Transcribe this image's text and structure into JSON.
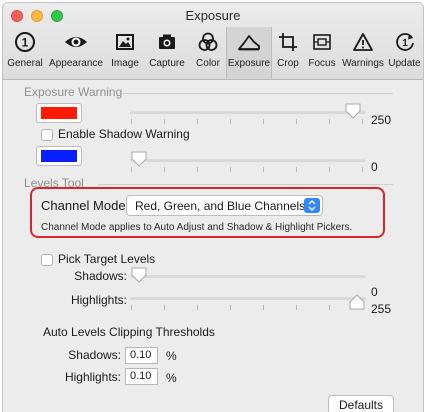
{
  "window": {
    "title": "Exposure"
  },
  "toolbar": {
    "selected": "Exposure",
    "items": [
      {
        "label": "General",
        "icon": "info-circle-icon"
      },
      {
        "label": "Appearance",
        "icon": "eye-icon"
      },
      {
        "label": "Image",
        "icon": "picture-icon"
      },
      {
        "label": "Capture",
        "icon": "camera-icon"
      },
      {
        "label": "Color",
        "icon": "color-circles-icon"
      },
      {
        "label": "Exposure",
        "icon": "histogram-icon"
      },
      {
        "label": "Crop",
        "icon": "crop-icon"
      },
      {
        "label": "Focus",
        "icon": "focus-icon"
      },
      {
        "label": "Warnings",
        "icon": "warning-triangle-icon"
      },
      {
        "label": "Update",
        "icon": "update-icon"
      }
    ]
  },
  "exposure_warning": {
    "title": "Exposure Warning",
    "highlight_color": "#ff1a00",
    "highlight_value": "250",
    "highlight_level": 250,
    "shadow_checkbox_label": "Enable Shadow Warning",
    "shadow_checked": false,
    "shadow_color": "#0a1fff",
    "shadow_value": "0",
    "shadow_level": 0
  },
  "levels_tool": {
    "title": "Levels Tool",
    "channel_mode_label": "Channel Mode:",
    "channel_mode_value": "Red, Green, and Blue Channels",
    "channel_mode_note": "Channel Mode applies to Auto Adjust and Shadow & Highlight Pickers.",
    "pick_target_label": "Pick Target Levels",
    "pick_target_checked": false,
    "shadows_label": "Shadows:",
    "shadows_value": "0",
    "shadows_level": 0,
    "highlights_label": "Highlights:",
    "highlights_value": "255",
    "highlights_level": 255
  },
  "clipping": {
    "title": "Auto Levels Clipping Thresholds",
    "shadows_label": "Shadows:",
    "shadows_value": "0.10",
    "highlights_label": "Highlights:",
    "highlights_value": "0.10",
    "unit": "%"
  },
  "footer": {
    "defaults_label": "Defaults"
  }
}
